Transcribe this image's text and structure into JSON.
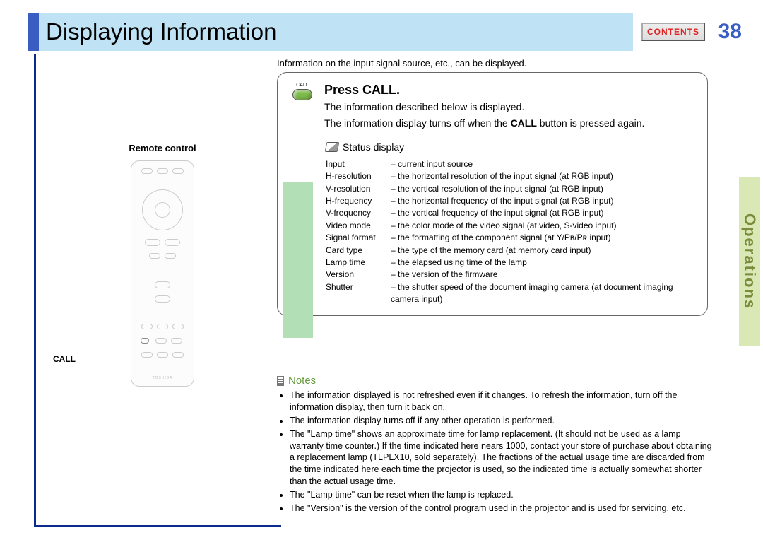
{
  "header": {
    "title": "Displaying Information",
    "contents_label": "CONTENTS",
    "page_number": "38"
  },
  "side_tab": "Operations",
  "intro": "Information on the input signal source, etc., can be displayed.",
  "left": {
    "remote_label": "Remote control",
    "call_label": "CALL",
    "remote_logo": "TOSHIBA"
  },
  "panel": {
    "call_icon_label": "CALL",
    "heading": "Press CALL.",
    "desc_line1": "The information described below is displayed.",
    "desc_line2_a": "The information display turns off when the ",
    "desc_line2_bold": "CALL",
    "desc_line2_b": " button is pressed again.",
    "status_label": "Status display",
    "rows": [
      {
        "k": "Input",
        "v": "– current input source"
      },
      {
        "k": "H-resolution",
        "v": "– the horizontal resolution of the input signal (at RGB input)"
      },
      {
        "k": "V-resolution",
        "v": "– the vertical resolution of the input signal (at RGB input)"
      },
      {
        "k": "H-frequency",
        "v": "– the horizontal frequency of the input signal (at RGB input)"
      },
      {
        "k": "V-frequency",
        "v": "– the vertical frequency of the input signal (at RGB input)"
      },
      {
        "k": "Video mode",
        "v": "– the color mode of the video signal (at video, S-video input)"
      },
      {
        "k": "Signal format",
        "v": "– the formatting of the component signal (at Y/Pʙ/Pʀ input)"
      },
      {
        "k": "Card type",
        "v": "– the type of the memory card (at memory card input)"
      },
      {
        "k": "Lamp time",
        "v": "– the elapsed using time of the lamp"
      },
      {
        "k": "Version",
        "v": "– the version of the firmware"
      },
      {
        "k": "Shutter",
        "v": "– the shutter speed of the document imaging camera (at document imaging camera input)"
      }
    ]
  },
  "notes": {
    "heading": "Notes",
    "items": [
      "The information displayed is not refreshed even if it changes. To refresh the information, turn off the information display, then turn it back on.",
      "The information display turns off if any other operation is performed.",
      "The \"Lamp time\" shows an approximate time for lamp replacement. (It should not be used as a lamp warranty time counter.) If the time indicated here nears 1000, contact your store of purchase about obtaining a replacement lamp (TLPLX10, sold separately). The fractions of the actual usage time are discarded from the time indicated here each time the projector is used, so the indicated time is actually somewhat shorter than the actual usage time.",
      "The \"Lamp time\" can be reset when the lamp is replaced.",
      "The \"Version\" is the version of the control program used in the projector and is used for servicing, etc."
    ]
  }
}
